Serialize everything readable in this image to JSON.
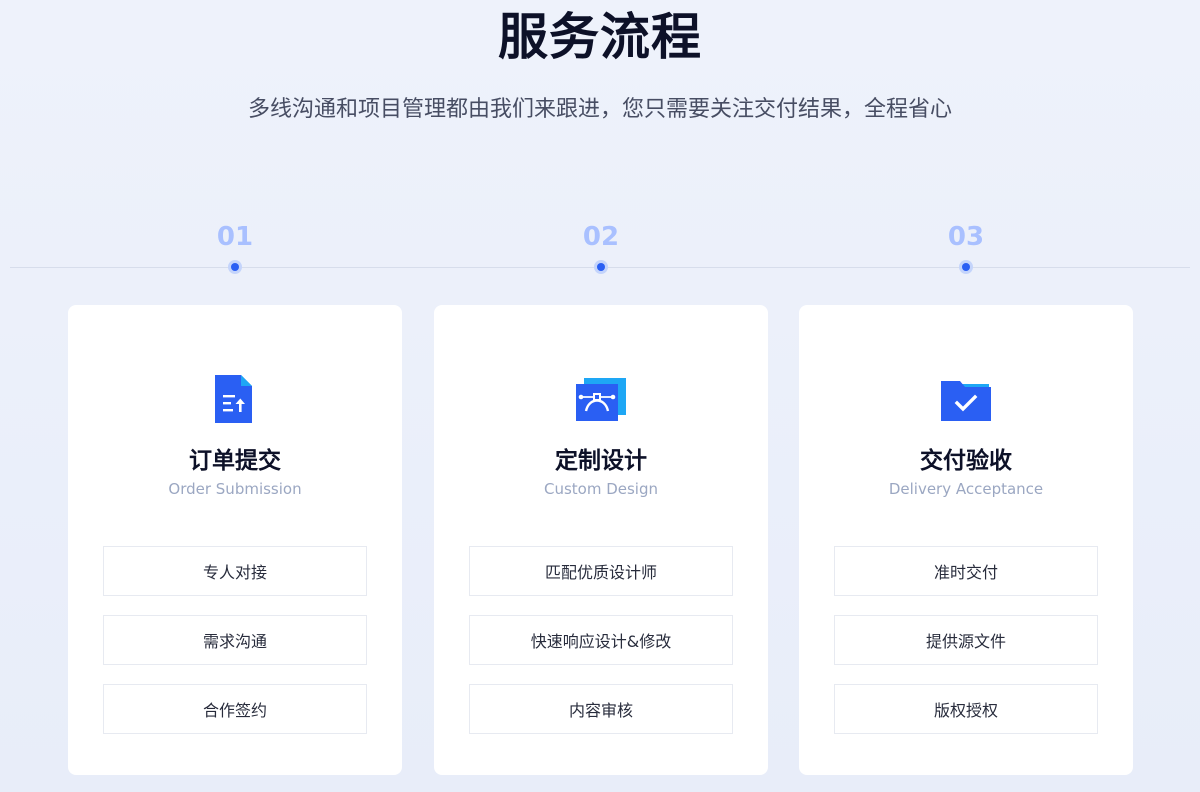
{
  "header": {
    "title": "服务流程",
    "subtitle": "多线沟通和项目管理都由我们来跟进，您只需要关注交付结果，全程省心"
  },
  "steps": [
    {
      "number": "01",
      "icon": "document-upload-icon",
      "title": "订单提交",
      "subtitle": "Order Submission",
      "items": [
        "专人对接",
        "需求沟通",
        "合作签约"
      ]
    },
    {
      "number": "02",
      "icon": "design-pen-icon",
      "title": "定制设计",
      "subtitle": "Custom Design",
      "items": [
        "匹配优质设计师",
        "快速响应设计&修改",
        "内容审核"
      ]
    },
    {
      "number": "03",
      "icon": "folder-check-icon",
      "title": "交付验收",
      "subtitle": "Delivery Acceptance",
      "items": [
        "准时交付",
        "提供源文件",
        "版权授权"
      ]
    }
  ],
  "colors": {
    "accent": "#2a5ff3",
    "accent_light": "#1ea7f5",
    "step_number": "#a9c0ff",
    "title": "#0d1128"
  }
}
